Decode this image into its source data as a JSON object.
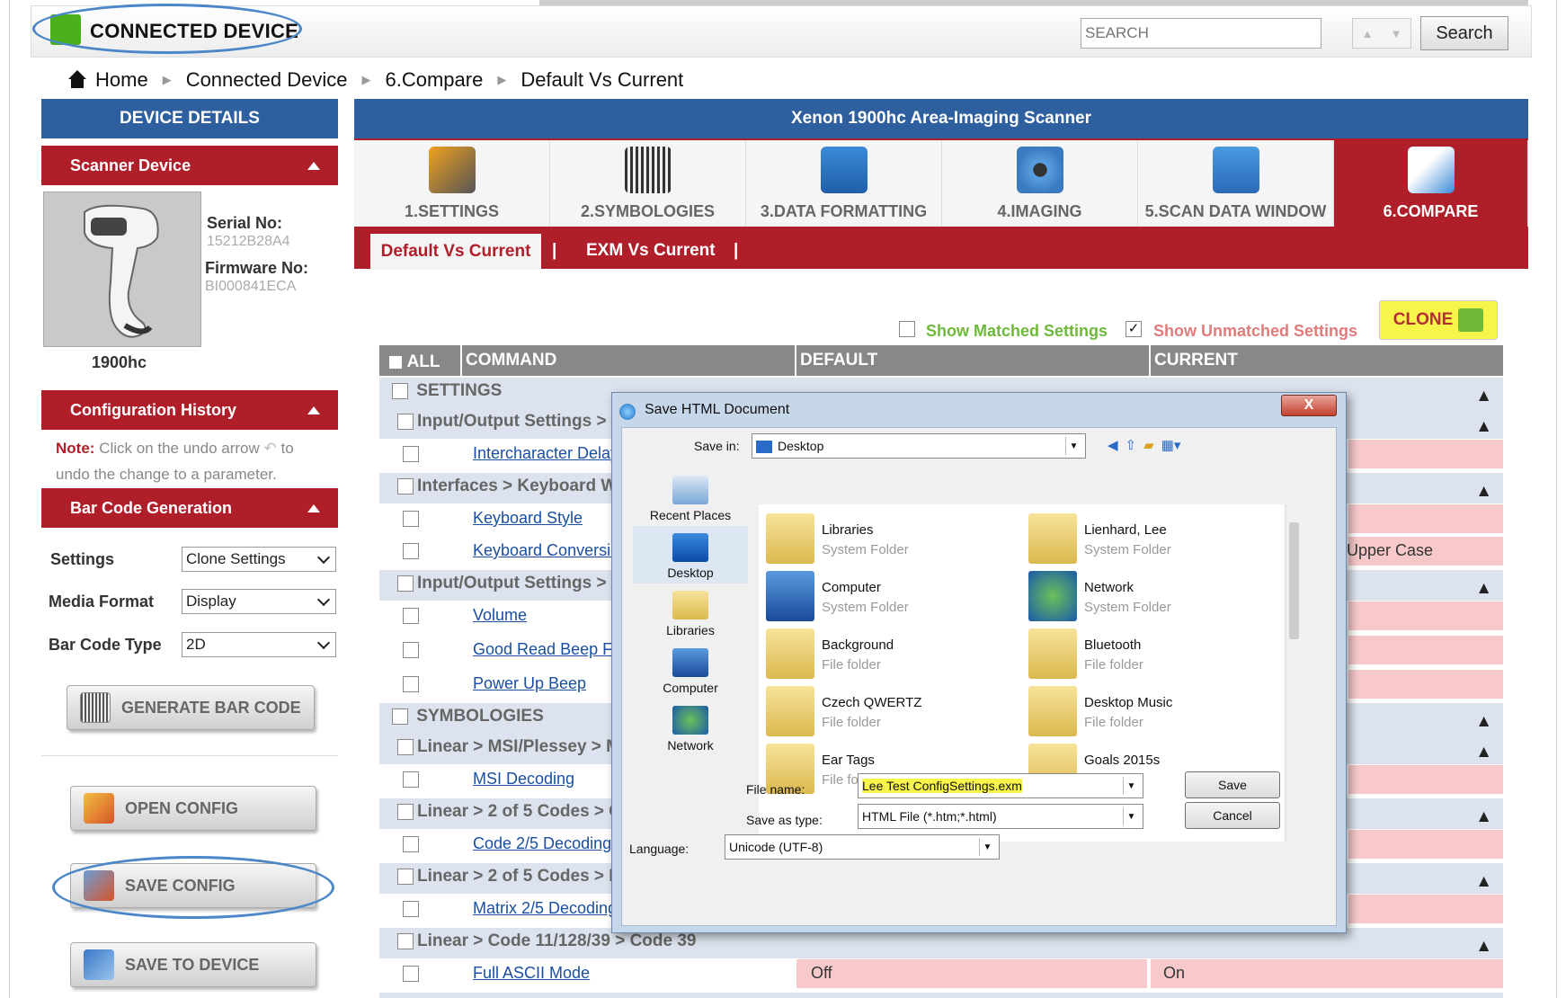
{
  "header": {
    "device_label": "CONNECTED DEVICE",
    "search_placeholder": "SEARCH",
    "search_button": "Search"
  },
  "breadcrumb": [
    "Home",
    "Connected Device",
    "6.Compare",
    "Default Vs Current"
  ],
  "sidebar": {
    "title": "DEVICE DETAILS",
    "scanner_section": "Scanner Device",
    "serial_label": "Serial No:",
    "serial_value": "15212B28A4",
    "firmware_label": "Firmware No:",
    "firmware_value": "BI000841ECA",
    "model": "1900hc",
    "history_section": "Configuration History",
    "note_label": "Note:",
    "note_text_1": "Click on the undo arrow",
    "note_text_2": "to",
    "note_text_3": "undo the change to a parameter.",
    "barcode_section": "Bar Code Generation",
    "settings_label": "Settings",
    "settings_value": "Clone Settings",
    "media_label": "Media Format",
    "media_value": "Display",
    "type_label": "Bar Code Type",
    "type_value": "2D",
    "generate_button": "GENERATE BAR CODE",
    "open_button": "OPEN CONFIG",
    "save_button": "SAVE CONFIG",
    "device_button": "SAVE TO DEVICE"
  },
  "main": {
    "title": "Xenon 1900hc Area-Imaging Scanner",
    "tabs": [
      "1.SETTINGS",
      "2.SYMBOLOGIES",
      "3.DATA FORMATTING",
      "4.IMAGING",
      "5.SCAN DATA WINDOW",
      "6.COMPARE"
    ],
    "subtabs": [
      "Default Vs Current",
      "EXM Vs Current"
    ],
    "show_matched": "Show Matched Settings",
    "show_unmatched": "Show Unmatched Settings",
    "clone_button": "CLONE",
    "columns": [
      "ALL",
      "COMMAND",
      "DEFAULT",
      "CURRENT"
    ],
    "rows": [
      {
        "type": "group",
        "label": "SETTINGS"
      },
      {
        "type": "group",
        "label": "Input/Output Settings > I"
      },
      {
        "type": "item",
        "label": "Intercharacter Delay"
      },
      {
        "type": "group",
        "label": "Interfaces > Keyboard W"
      },
      {
        "type": "item",
        "label": "Keyboard Style"
      },
      {
        "type": "item",
        "label": "Keyboard Conversio",
        "current": "Upper Case"
      },
      {
        "type": "group",
        "label": "Input/Output Settings > I"
      },
      {
        "type": "item",
        "label": "Volume"
      },
      {
        "type": "item",
        "label": "Good Read Beep Fr"
      },
      {
        "type": "item",
        "label": "Power Up Beep"
      },
      {
        "type": "group",
        "label": "SYMBOLOGIES"
      },
      {
        "type": "group",
        "label": "Linear > MSI/Plessey > M"
      },
      {
        "type": "item",
        "label": "MSI Decoding"
      },
      {
        "type": "group",
        "label": "Linear > 2 of 5 Codes > C"
      },
      {
        "type": "item",
        "label": "Code 2/5 Decoding"
      },
      {
        "type": "group",
        "label": "Linear > 2 of 5 Codes > M"
      },
      {
        "type": "item",
        "label": "Matrix 2/5 Decoding"
      },
      {
        "type": "group",
        "label": "Linear > Code 11/128/39 > Code 39"
      },
      {
        "type": "item",
        "label": "Full ASCII Mode",
        "default": "Off",
        "current": "On"
      }
    ]
  },
  "dialog": {
    "title": "Save HTML Document",
    "close": "X",
    "save_in_label": "Save in:",
    "save_in_value": "Desktop",
    "places": [
      "Recent Places",
      "Desktop",
      "Libraries",
      "Computer",
      "Network"
    ],
    "files": [
      {
        "name": "Libraries",
        "type": "System Folder"
      },
      {
        "name": "Lienhard, Lee",
        "type": "System Folder"
      },
      {
        "name": "Computer",
        "type": "System Folder"
      },
      {
        "name": "Network",
        "type": "System Folder"
      },
      {
        "name": "Background",
        "type": "File folder"
      },
      {
        "name": "Bluetooth",
        "type": "File folder"
      },
      {
        "name": "Czech QWERTZ",
        "type": "File folder"
      },
      {
        "name": "Desktop Music",
        "type": "File folder"
      },
      {
        "name": "Ear Tags",
        "type": "File folder"
      },
      {
        "name": "Goals 2015s",
        "type": "File folder"
      }
    ],
    "file_name_label": "File name:",
    "file_name_value": "Lee Test ConfigSettings.exm",
    "save_type_label": "Save as type:",
    "save_type_value": "HTML File (*.htm;*.html)",
    "language_label": "Language:",
    "language_value": "Unicode (UTF-8)",
    "save_button": "Save",
    "cancel_button": "Cancel"
  },
  "colors": {
    "brand_red": "#b01e2a",
    "brand_blue": "#2e5f9e",
    "highlight": "#f7f44a",
    "mismatch": "#f7c9cb"
  }
}
